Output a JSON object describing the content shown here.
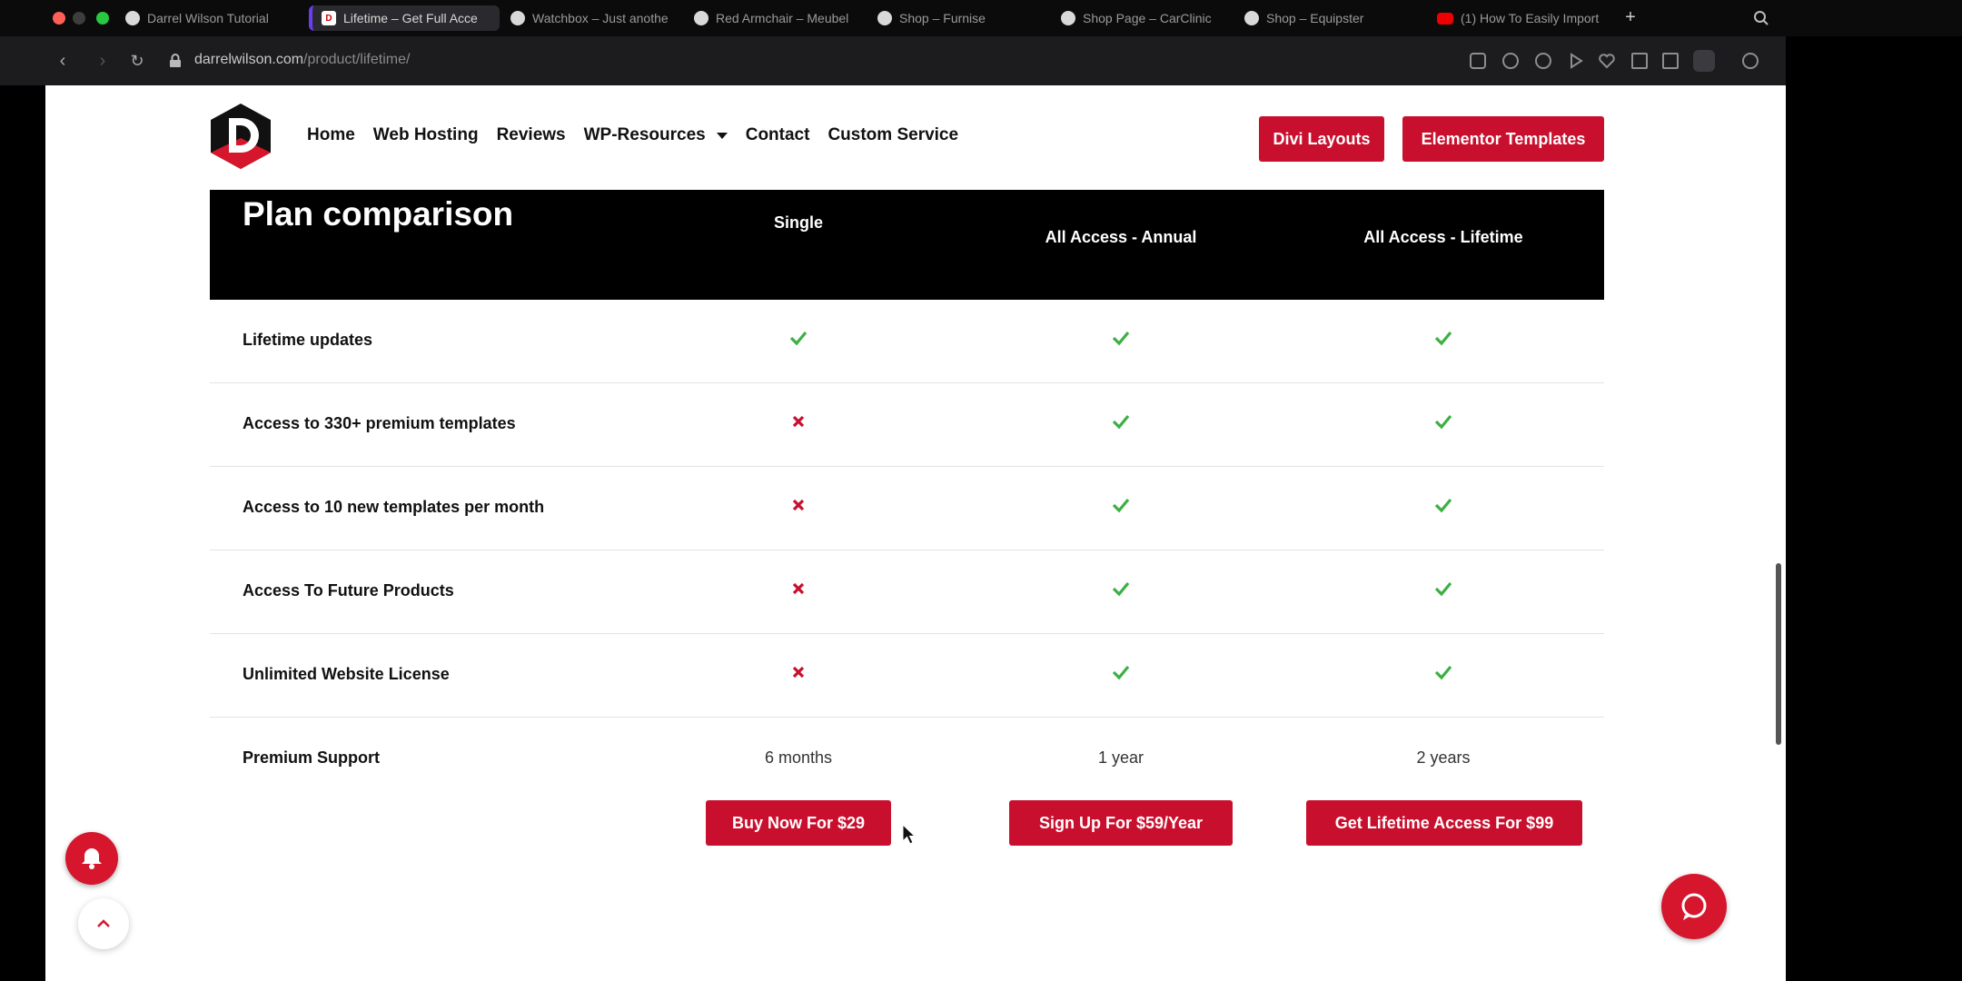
{
  "browser": {
    "tabs": [
      {
        "label": "Darrel Wilson Tutorial",
        "icon": "globe-icon",
        "active": false
      },
      {
        "label": "Lifetime – Get Full Acce",
        "icon": "d-logo-icon",
        "active": true
      },
      {
        "label": "Watchbox – Just anothe",
        "icon": "globe-icon",
        "active": false
      },
      {
        "label": "Red Armchair – Meubel",
        "icon": "globe-icon",
        "active": false
      },
      {
        "label": "Shop – Furnise",
        "icon": "globe-icon",
        "active": false
      },
      {
        "label": "Shop Page – CarClinic",
        "icon": "globe-icon",
        "active": false
      },
      {
        "label": "Shop – Equipster",
        "icon": "globe-icon",
        "active": false
      },
      {
        "label": "(1) How To Easily Import",
        "icon": "youtube-icon",
        "active": false
      }
    ],
    "url_domain": "darrelwilson.com",
    "url_path": "/product/lifetime/"
  },
  "header": {
    "nav": [
      {
        "label": "Home"
      },
      {
        "label": "Web Hosting"
      },
      {
        "label": "Reviews"
      },
      {
        "label": "WP-Resources",
        "dropdown": true
      },
      {
        "label": "Contact"
      },
      {
        "label": "Custom Service"
      }
    ],
    "btn_divi": "Divi Layouts",
    "btn_elementor": "Elementor Templates"
  },
  "comparison": {
    "title": "Plan comparison",
    "columns": [
      "Single",
      "All Access - Annual",
      "All Access - Lifetime"
    ],
    "rows": [
      {
        "label": "Lifetime updates",
        "values": [
          "check",
          "check",
          "check"
        ]
      },
      {
        "label": "Access to 330+ premium templates",
        "values": [
          "cross",
          "check",
          "check"
        ]
      },
      {
        "label": "Access to 10 new templates per month",
        "values": [
          "cross",
          "check",
          "check"
        ]
      },
      {
        "label": "Access To Future Products",
        "values": [
          "cross",
          "check",
          "check"
        ]
      },
      {
        "label": "Unlimited Website License",
        "values": [
          "cross",
          "check",
          "check"
        ]
      },
      {
        "label": "Premium Support",
        "values": [
          "6 months",
          "1 year",
          "2 years"
        ]
      }
    ],
    "buttons": [
      "Buy Now For $29",
      "Sign Up For $59/Year",
      "Get Lifetime Access For $99"
    ]
  },
  "colors": {
    "brand_red": "#c8102e",
    "check_green": "#3cb043",
    "cross_red": "#c8102e"
  }
}
